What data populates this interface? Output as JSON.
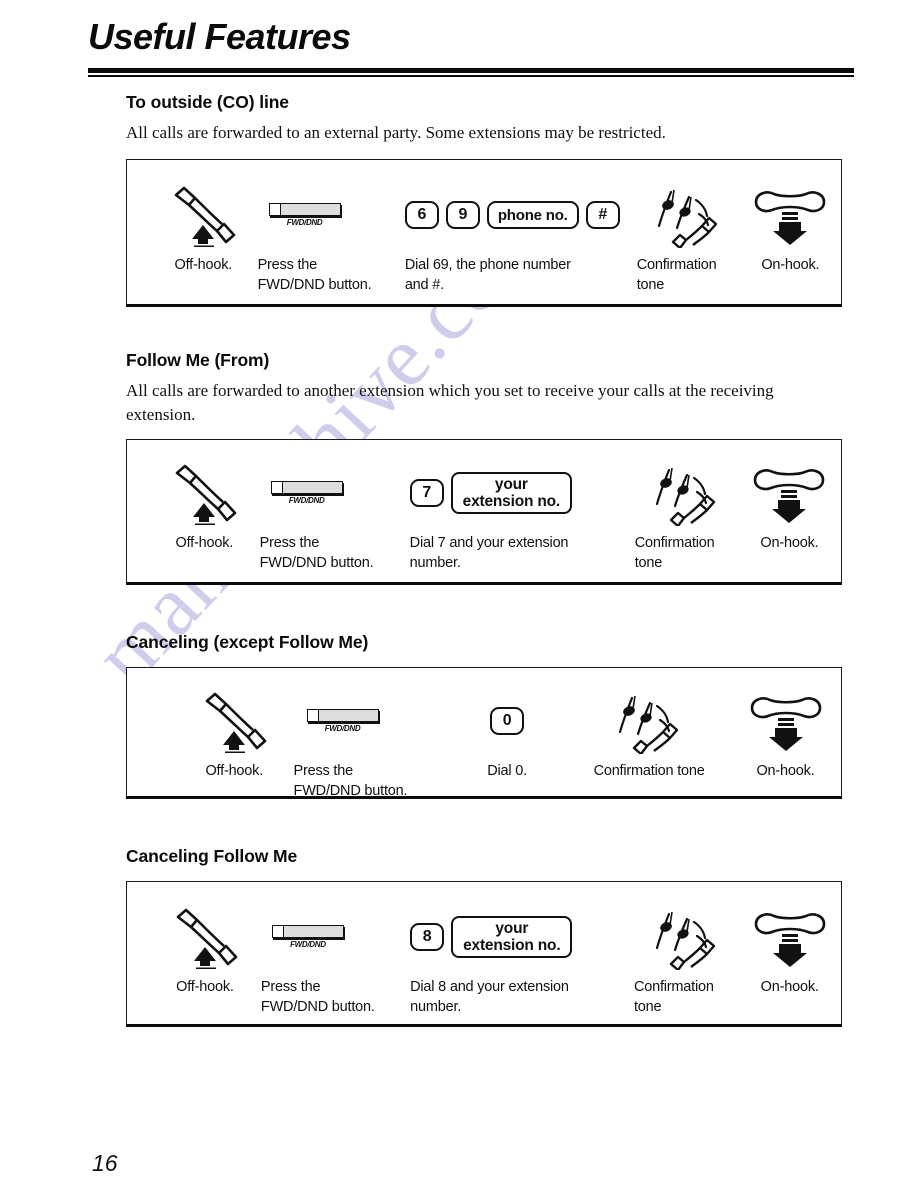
{
  "page": {
    "title": "Useful Features",
    "number": "16",
    "watermark": "manualshive.com",
    "watermark_color": "#c9c9ea"
  },
  "sections": [
    {
      "heading": "To outside (CO) line",
      "body": "All calls are forwarded to an external party. Some extensions may be restricted.",
      "steps": [
        {
          "icon": "handset-off-hook-icon",
          "label": "Off-hook."
        },
        {
          "icon": "fwd-dnd-button-icon",
          "button_label": "FWD/DND",
          "label": "Press the\nFWD/DND button."
        },
        {
          "icon": "dial-keys-icon",
          "keys": [
            "6",
            "9",
            "phone no.",
            "#"
          ],
          "label": "Dial 69, the phone number\nand #."
        },
        {
          "icon": "confirmation-tone-icon",
          "label": "Confirmation\ntone"
        },
        {
          "icon": "handset-on-hook-icon",
          "label": "On-hook."
        }
      ]
    },
    {
      "heading": "Follow Me (From)",
      "body": "All calls are forwarded to another extension which you set to receive your calls at the receiving extension.",
      "steps": [
        {
          "icon": "handset-off-hook-icon",
          "label": "Off-hook."
        },
        {
          "icon": "fwd-dnd-button-icon",
          "button_label": "FWD/DND",
          "label": "Press the\nFWD/DND button."
        },
        {
          "icon": "dial-keys-icon",
          "keys": [
            "7"
          ],
          "key_twoline": [
            "your",
            "extension no."
          ],
          "label": "Dial 7 and your extension\nnumber."
        },
        {
          "icon": "confirmation-tone-icon",
          "label": "Confirmation\ntone"
        },
        {
          "icon": "handset-on-hook-icon",
          "label": "On-hook."
        }
      ]
    },
    {
      "heading": "Canceling (except Follow Me)",
      "body": "",
      "steps": [
        {
          "icon": "handset-off-hook-icon",
          "label": "Off-hook."
        },
        {
          "icon": "fwd-dnd-button-icon",
          "button_label": "FWD/DND",
          "label": "Press the\nFWD/DND button."
        },
        {
          "icon": "dial-keys-icon",
          "keys": [
            "0"
          ],
          "label": "Dial 0."
        },
        {
          "icon": "confirmation-tone-icon",
          "label": "Confirmation tone"
        },
        {
          "icon": "handset-on-hook-icon",
          "label": "On-hook."
        }
      ]
    },
    {
      "heading": "Canceling Follow Me",
      "body": "",
      "steps": [
        {
          "icon": "handset-off-hook-icon",
          "label": "Off-hook."
        },
        {
          "icon": "fwd-dnd-button-icon",
          "button_label": "FWD/DND",
          "label": "Press the\nFWD/DND button."
        },
        {
          "icon": "dial-keys-icon",
          "keys": [
            "8"
          ],
          "key_twoline": [
            "your",
            "extension no."
          ],
          "label": "Dial 8 and your extension\nnumber."
        },
        {
          "icon": "confirmation-tone-icon",
          "label": "Confirmation\ntone"
        },
        {
          "icon": "handset-on-hook-icon",
          "label": "On-hook."
        }
      ]
    }
  ]
}
